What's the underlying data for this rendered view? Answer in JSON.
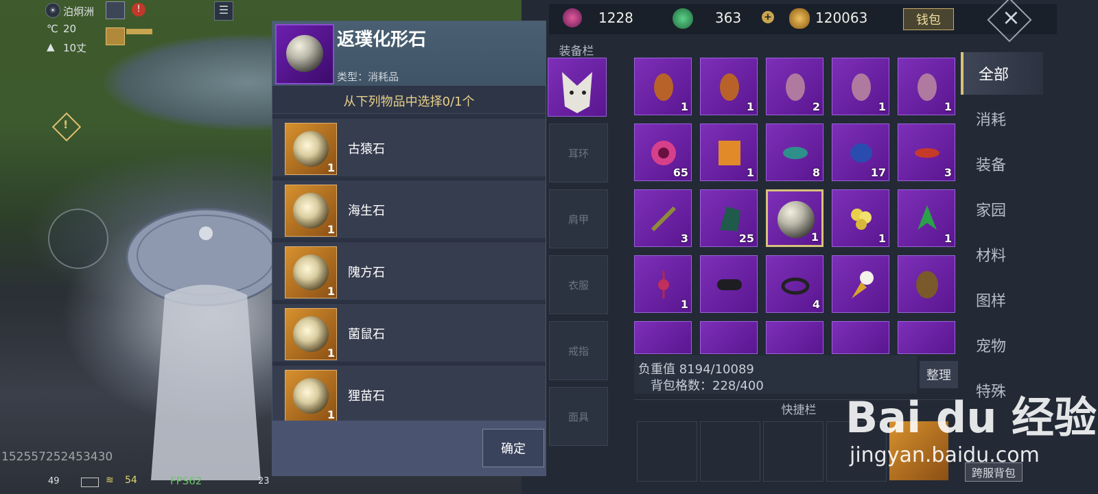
{
  "hud": {
    "location": "泊炯洲",
    "temperature": "20",
    "distance": "10丈",
    "player_id": "152557252453430",
    "ping": "49",
    "signal": "54",
    "fps": "FPS62",
    "count": "23"
  },
  "currency": {
    "c1": "1228",
    "c2": "363",
    "c3": "120063",
    "wallet_label": "钱包"
  },
  "popup": {
    "title": "返璞化形石",
    "type": "类型：消耗品",
    "subtitle": "从下列物品中选择0/1个",
    "confirm": "确定",
    "items": [
      {
        "name": "古猿石",
        "count": "1"
      },
      {
        "name": "海生石",
        "count": "1"
      },
      {
        "name": "隗方石",
        "count": "1"
      },
      {
        "name": "菌鼠石",
        "count": "1"
      },
      {
        "name": "狸苗石",
        "count": "1"
      }
    ]
  },
  "equipment": {
    "label": "装备栏",
    "slots": [
      "耳环",
      "肩甲",
      "衣服",
      "戒指",
      "面具"
    ]
  },
  "inventory": {
    "counts": [
      "1",
      "1",
      "2",
      "1",
      "1",
      "65",
      "1",
      "8",
      "17",
      "3",
      "3",
      "25",
      "1",
      "1",
      "1",
      "1",
      "",
      "4",
      "",
      ""
    ],
    "weight": "负重值 8194/10089",
    "slots": "背包格数：228/400",
    "sort": "整理",
    "quickbar": "快捷栏",
    "cross_server": "跨服背包"
  },
  "tabs": [
    "全部",
    "消耗",
    "装备",
    "家园",
    "材料",
    "图样",
    "宠物",
    "特殊"
  ],
  "watermark": {
    "logo": "Bai du 经验",
    "url": "jingyan.baidu.com"
  }
}
